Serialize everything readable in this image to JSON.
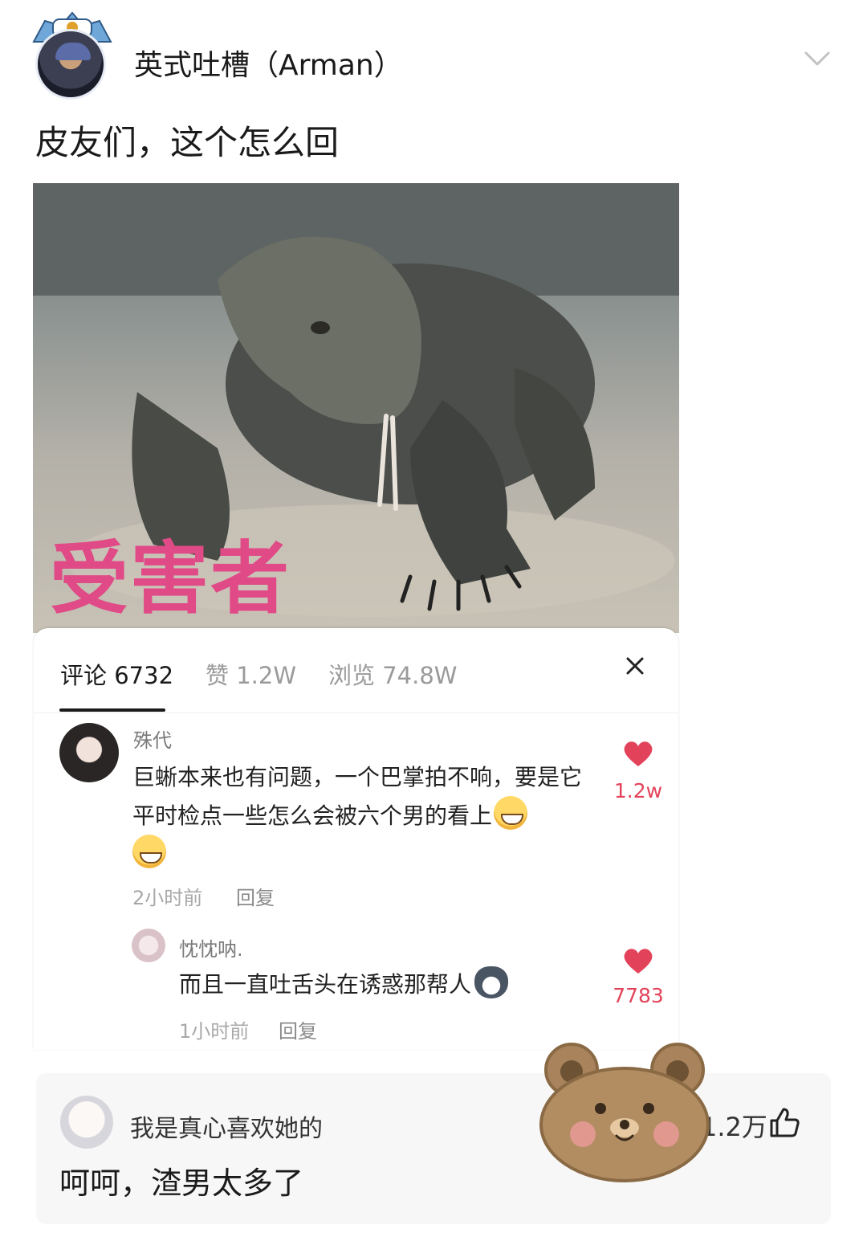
{
  "post": {
    "author": "英式吐槽（Arman）",
    "text": "皮友们，这个怎么回",
    "image_caption": "受害者"
  },
  "comment_panel": {
    "tabs": {
      "comments": "评论 6732",
      "likes": "赞 1.2W",
      "views": "浏览 74.8W"
    },
    "comments": [
      {
        "user": "殊代",
        "body": "巨蜥本来也有问题，一个巴掌拍不响，要是它平时检点一些怎么会被六个男的看上",
        "time": "2小时前",
        "reply_label": "回复",
        "likes": "1.2w",
        "emoji": "grinning-sweat-emoji"
      },
      {
        "user": "忱忱呐.",
        "body": "而且一直吐舌头在诱惑那帮人",
        "time": "1小时前",
        "reply_label": "回复",
        "likes": "7783",
        "emoji": "dog-emoji"
      }
    ]
  },
  "bottom_comment": {
    "user": "我是真心喜欢她的",
    "body": "呵呵，渣男太多了",
    "likes": "1.2万"
  },
  "icons": {
    "header": "chevron-down-icon",
    "panel_close": "close-icon",
    "comment_like": "heart-icon",
    "bottom_like": "thumbs-up-icon",
    "sticker": "bear-sticker"
  },
  "colors": {
    "like_red": "#e3435a",
    "caption_pink": "#e04a86",
    "muted_text": "#9a9a9a"
  }
}
